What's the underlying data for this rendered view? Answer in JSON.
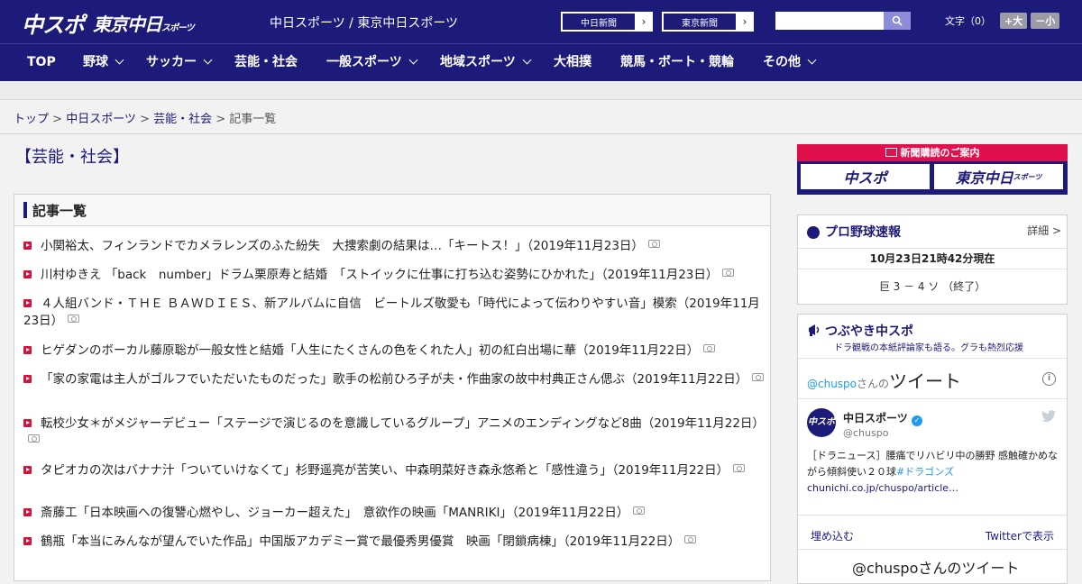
{
  "header": {
    "logo_main": "中スポ",
    "logo_tokyo": "東京中日",
    "logo_tokyo_small": "スポーツ",
    "site_title": "中日スポーツ / 東京中日スポーツ",
    "ext_links": [
      {
        "label": "中日新聞"
      },
      {
        "label": "東京新聞"
      }
    ],
    "search_placeholder": "",
    "fontsize_label": "文字（0）",
    "font_larger": "+大",
    "font_smaller": "－小"
  },
  "nav": {
    "items": [
      {
        "label": "TOP",
        "dropdown": false
      },
      {
        "label": "野球",
        "dropdown": true
      },
      {
        "label": "サッカー",
        "dropdown": true
      },
      {
        "label": "芸能・社会",
        "dropdown": false
      },
      {
        "label": "一般スポーツ",
        "dropdown": true
      },
      {
        "label": "地域スポーツ",
        "dropdown": true
      },
      {
        "label": "大相撲",
        "dropdown": false
      },
      {
        "label": "競馬・ボート・競輪",
        "dropdown": false
      },
      {
        "label": "その他",
        "dropdown": true
      }
    ]
  },
  "breadcrumb": {
    "items": [
      "トップ",
      "中日スポーツ",
      "芸能・社会"
    ],
    "separator": " > ",
    "current": "記事一覧"
  },
  "category_title": "【芸能・社会】",
  "article_list": {
    "heading": "記事一覧",
    "items": [
      {
        "text": "小関裕太、フィンランドでカメラレンズのふた紛失　大捜索劇の結果は…「キートス！」（2019年11月23日）"
      },
      {
        "text": "川村ゆきえ 「back　number」ドラム栗原寿と結婚　「ストイックに仕事に打ち込む姿勢にひかれた」（2019年11月23日）"
      },
      {
        "text": "４人組バンド・ＴＨＥ ＢＡＷＤＩＥＳ、新アルバムに自信　ビートルズ敬愛も「時代によって伝わりやすい音」模索（2019年11月23日）"
      },
      {
        "text": "ヒゲダンのボーカル藤原聡が一般女性と結婚「人生にたくさんの色をくれた人」初の紅白出場に華（2019年11月22日）"
      },
      {
        "text": "「家の家電は主人がゴルフでいただいたものだった」歌手の松前ひろ子が夫・作曲家の故中村典正さん偲ぶ（2019年11月22日）"
      },
      {
        "text": "転校少女＊がメジャーデビュー「ステージで演じるのを意識しているグループ」アニメのエンディングなど8曲（2019年11月22日）"
      },
      {
        "text": "タピオカの次はバナナ汁「ついていけなくて」杉野遥亮が苦笑い、中森明菜好き森永悠希と「感性違う」（2019年11月22日）"
      },
      {
        "text": "斎藤工「日本映画への復讐心燃やし、ジョーカー超えた」　意欲作の映画「MANRIKI」（2019年11月22日）"
      },
      {
        "text": "鶴瓶「本当にみんなが望んでいた作品」中国版アカデミー賞で最優秀男優賞　映画「閉鎖病棟」（2019年11月22日）"
      }
    ]
  },
  "promo": {
    "header": "新聞購読のご案内",
    "left": "中スポ",
    "right": "東京中日",
    "right_small": "スポーツ"
  },
  "baseball": {
    "title": "プロ野球速報",
    "more": "詳細 >",
    "timestamp": "10月23日21時42分現在",
    "score": "巨 3 － 4 ソ （終了）"
  },
  "tweets": {
    "title": "つぶやき中スポ",
    "subtitle": "ドラ観戦の本紙評論家も語る。グラも熱烈応援",
    "widget_handle": "@chuspo",
    "widget_suffix": "さんの",
    "widget_title": "ツイート",
    "account_name": "中日スポーツ",
    "account_handle": "@chuspo",
    "tweet_text": "［ドラニュース］腰痛でリハビリ中の勝野 感触確かめながら傾斜使い２０球",
    "tweet_hashtag": "#ドラゴンズ",
    "tweet_link": "chunichi.co.jp/chuspo/article…",
    "embed": "埋め込む",
    "view_on_twitter": "Twitterで表示",
    "footer_handle": "@chuspo",
    "footer_suffix": "さんのツイート"
  },
  "colors": {
    "brand_navy": "#1d1b79",
    "accent_red": "#d0143c",
    "twitter_blue": "#1d9bf0"
  }
}
